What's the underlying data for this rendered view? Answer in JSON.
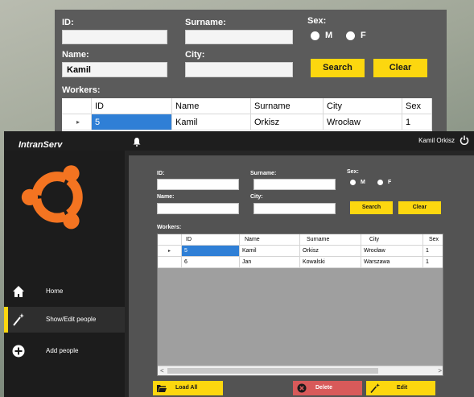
{
  "zoom": {
    "labels": {
      "id": "ID:",
      "surname": "Surname:",
      "sex": "Sex:",
      "name": "Name:",
      "city": "City:",
      "workers": "Workers:"
    },
    "fields": {
      "id": "",
      "surname": "",
      "name": "Kamil",
      "city": ""
    },
    "sex_options": [
      "M",
      "F"
    ],
    "buttons": {
      "search": "Search",
      "clear": "Clear"
    },
    "grid": {
      "columns": [
        "ID",
        "Name",
        "Surname",
        "City",
        "Sex"
      ],
      "row_marker": "▸",
      "rows": [
        [
          "5",
          "Kamil",
          "Orkisz",
          "Wrocław",
          "1"
        ]
      ]
    }
  },
  "app": {
    "title": "IntranServ",
    "user_name": "Kamil Orkisz",
    "accent_color": "#fcd70f",
    "nav": [
      {
        "label": "Home",
        "icon": "home-icon"
      },
      {
        "label": "Show/Edit people",
        "icon": "magic-wand-icon",
        "active": true
      },
      {
        "label": "Add people",
        "icon": "plus-circle-icon"
      }
    ],
    "form": {
      "labels": {
        "id": "ID:",
        "surname": "Surname:",
        "sex": "Sex:",
        "name": "Name:",
        "city": "City:",
        "workers": "Workers:"
      },
      "fields": {
        "id": "",
        "surname": "",
        "name": "",
        "city": ""
      },
      "sex_options": [
        "M",
        "F"
      ],
      "buttons": {
        "search": "Search",
        "clear": "Clear"
      }
    },
    "grid": {
      "columns": [
        "ID",
        "Name",
        "Surname",
        "City",
        "Sex"
      ],
      "row_marker": "▸",
      "selected_row": 0,
      "rows": [
        [
          "5",
          "Kamil",
          "Orkisz",
          "Wrocław",
          "1"
        ],
        [
          "6",
          "Jan",
          "Kowalski",
          "Warszawa",
          "1"
        ]
      ],
      "scroll_left": "<",
      "scroll_right": ">"
    },
    "actions": {
      "load_all": "Load All",
      "delete": "Delete",
      "edit": "Edit"
    },
    "colors": {
      "delete": "#d85a5a",
      "selection": "#2f7fd6"
    }
  }
}
